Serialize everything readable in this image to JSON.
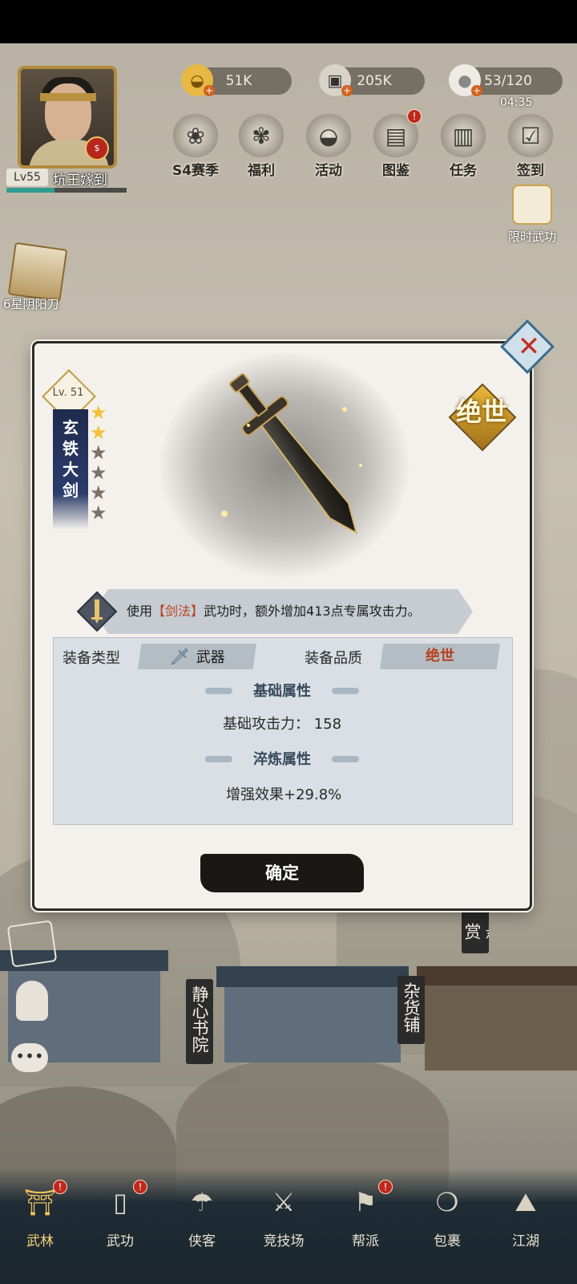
{
  "resources": [
    {
      "name": "gold-ingot",
      "value": "51K"
    },
    {
      "name": "coin",
      "value": "205K"
    },
    {
      "name": "stamina-bun",
      "value": "53/120"
    }
  ],
  "timer": "04:35",
  "player": {
    "level": "Lv55",
    "name": "坑王嫁到"
  },
  "top_menu": [
    {
      "label": "S4赛季",
      "icon": "season-icon",
      "glyph": "❀",
      "badge": false
    },
    {
      "label": "福利",
      "icon": "knot-icon",
      "glyph": "✾",
      "badge": false
    },
    {
      "label": "活动",
      "icon": "fan-icon",
      "glyph": "◒",
      "badge": false
    },
    {
      "label": "图鉴",
      "icon": "scroll-icon",
      "glyph": "▤",
      "badge": true
    },
    {
      "label": "任务",
      "icon": "task-scroll-icon",
      "glyph": "▥",
      "badge": false
    },
    {
      "label": "签到",
      "icon": "checkin-icon",
      "glyph": "☑",
      "badge": false
    }
  ],
  "limited_skill": "限时武功",
  "side_item": "6星阴阳刀",
  "item": {
    "level": "Lv. 51",
    "name": "玄铁大剑",
    "stars_total": 6,
    "stars_filled": 2,
    "quality_badge": "绝世",
    "effect_prefix": "使用",
    "effect_highlight": "【剑法】",
    "effect_suffix": "武功时，额外增加413点专属攻击力。",
    "type_label": "装备类型",
    "type_value": "武器",
    "quality_label": "装备品质",
    "quality_value": "绝世",
    "base_title": "基础属性",
    "base_attack": "基础攻击力：  158",
    "refine_title": "淬炼属性",
    "refine_effect": "增强效果+29.8%"
  },
  "confirm_label": "确定",
  "scene_signs": {
    "bookhouse": "静心书院",
    "store": "杂货铺",
    "bounty": "悬赏"
  },
  "bottom_nav": [
    {
      "label": "武林",
      "icon": "pagoda-icon",
      "glyph": "⛩",
      "badge": true,
      "active": true
    },
    {
      "label": "武功",
      "icon": "martial-book-icon",
      "glyph": "▯",
      "badge": true,
      "active": false
    },
    {
      "label": "侠客",
      "icon": "hero-hat-icon",
      "glyph": "☂",
      "badge": false,
      "active": false
    },
    {
      "label": "竞技场",
      "icon": "crossed-swords-icon",
      "glyph": "⚔",
      "badge": false,
      "active": false
    },
    {
      "label": "帮派",
      "icon": "banner-icon",
      "glyph": "⚑",
      "badge": true,
      "active": false
    },
    {
      "label": "包裹",
      "icon": "bag-icon",
      "glyph": "❍",
      "badge": false,
      "active": false
    },
    {
      "label": "江湖",
      "icon": "mountain-icon",
      "glyph": "⛰",
      "badge": false,
      "active": false
    }
  ],
  "colors": {
    "accent_gold": "#f0c25a",
    "highlight_red": "#b8401e",
    "badge_red": "#c0281c"
  }
}
